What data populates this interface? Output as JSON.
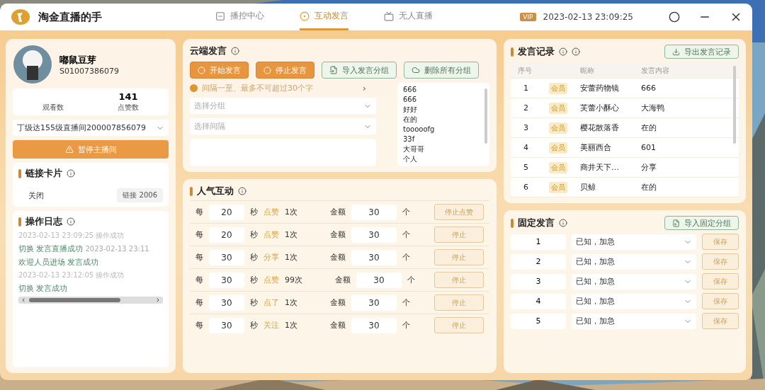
{
  "window": {
    "title": "淘金直播的手",
    "badge": "VIP",
    "datetime": "2023-02-13 23:09:25"
  },
  "tabs": [
    {
      "label": "播控中心",
      "selected": false
    },
    {
      "label": "互动发言",
      "selected": true
    },
    {
      "label": "无人直播",
      "selected": false
    }
  ],
  "profile": {
    "name": "嘟鼠豆芽",
    "id": "S01007386079",
    "stats": [
      {
        "label": "观看数"
      },
      {
        "value": "141",
        "label": "点赞数"
      }
    ],
    "account": "丁级达155级直播间200007856079",
    "action": "暂停主播间"
  },
  "link_card": {
    "title": "链接卡片",
    "status": "关闭",
    "tag": "链接 2006"
  },
  "log": {
    "title": "操作日志",
    "lines": [
      {
        "kind": "time",
        "text": "2023-02-13 23:09:25 操作成功"
      },
      {
        "kind": "event",
        "text": "切换 发言直播成功",
        "time": "2023-02-13 23:11"
      },
      {
        "kind": "event",
        "text": "欢迎人员进场 发言成功"
      },
      {
        "kind": "time",
        "text": "2023-02-13 23:12:05 操作成功"
      },
      {
        "kind": "event",
        "text": "切换 发言成功"
      }
    ]
  },
  "cloud": {
    "title": "云端发言",
    "buttons": [
      {
        "kind": "primary",
        "label": "开始发言"
      },
      {
        "kind": "primary",
        "label": "停止发言"
      },
      {
        "kind": "outline",
        "label": "导入发言分组"
      },
      {
        "kind": "outline",
        "label": "删除所有分组"
      }
    ],
    "hint": "间隔一至、最多不可超过30个字",
    "hint_arrow": "›",
    "selects": [
      {
        "placeholder": "选择分组"
      },
      {
        "placeholder": "选择间隔"
      }
    ],
    "messages": [
      "666",
      "666",
      "好好",
      "在的",
      "tooooofg",
      "33f",
      "大哥哥",
      "个人"
    ]
  },
  "interact": {
    "title": "人气互动",
    "rows": [
      {
        "every": "每",
        "seconds": "20",
        "unit": "秒",
        "action": "点赞",
        "times": "1次",
        "amount_label": "金额",
        "amount": "30",
        "count_unit": "个",
        "button": "停止点赞"
      },
      {
        "every": "每",
        "seconds": "20",
        "unit": "秒",
        "action": "点赞",
        "times": "1次",
        "amount_label": "金额",
        "amount": "30",
        "count_unit": "个",
        "button": "停止"
      },
      {
        "every": "每",
        "seconds": "30",
        "unit": "秒",
        "action": "分享",
        "times": "1次",
        "amount_label": "金额",
        "amount": "30",
        "count_unit": "个",
        "button": "停止"
      },
      {
        "every": "每",
        "seconds": "30",
        "unit": "秒",
        "action": "点赞",
        "times": "99次",
        "amount_label": "金额",
        "amount": "30",
        "count_unit": "个",
        "button": "停止"
      },
      {
        "every": "每",
        "seconds": "30",
        "unit": "秒",
        "action": "点了",
        "times": "1次",
        "amount_label": "金额",
        "amount": "30",
        "count_unit": "个",
        "button": "停止"
      },
      {
        "every": "每",
        "seconds": "30",
        "unit": "秒",
        "action": "关注",
        "times": "1次",
        "amount_label": "金额",
        "amount": "30",
        "count_unit": "个",
        "button": "停止"
      }
    ]
  },
  "records": {
    "title": "发言记录",
    "export": "导出发言记录",
    "columns": [
      "序号",
      "昵称",
      "发言内容"
    ],
    "rows": [
      {
        "no": "1",
        "level": "会员",
        "nick": "安蕾药物镜",
        "content": "666"
      },
      {
        "no": "2",
        "level": "会员",
        "nick": "芙蕾小酥心",
        "content": "大海鸭"
      },
      {
        "no": "3",
        "level": "会员",
        "nick": "樱花散落香",
        "content": "在的"
      },
      {
        "no": "4",
        "level": "会员",
        "nick": "美丽西合",
        "content": "601"
      },
      {
        "no": "5",
        "level": "会员",
        "nick": "商井天下…",
        "content": "分享"
      },
      {
        "no": "6",
        "level": "会员",
        "nick": "贝鲸",
        "content": "在的"
      }
    ]
  },
  "fixed": {
    "title": "固定发言",
    "import": "导入固定分组",
    "rows": [
      {
        "no": "1",
        "text": "已知，加急",
        "button": "保存"
      },
      {
        "no": "2",
        "text": "已知，加急",
        "button": "保存"
      },
      {
        "no": "3",
        "text": "已知，加急",
        "button": "保存"
      },
      {
        "no": "4",
        "text": "已知，加急",
        "button": "保存"
      },
      {
        "no": "5",
        "text": "已知，加急",
        "button": "保存"
      }
    ]
  }
}
